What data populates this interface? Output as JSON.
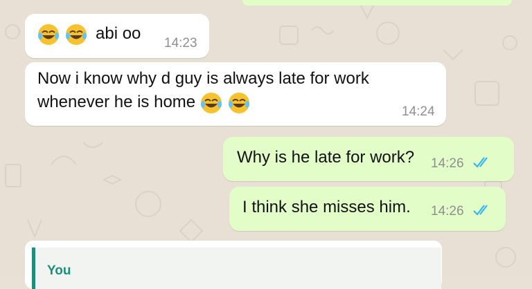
{
  "chat": {
    "messages": [
      {
        "direction": "incoming",
        "text": "abi oo",
        "time": "14:23",
        "emoji": "tears-of-joy-emoji"
      },
      {
        "direction": "incoming",
        "text": "Now i know why d guy is always late for work\nwhenever he is home",
        "time": "14:24",
        "emoji": "tears-of-joy-emoji"
      },
      {
        "direction": "outgoing",
        "text": "Why is he late for work?",
        "time": "14:26",
        "status": "read-double-tick"
      },
      {
        "direction": "outgoing",
        "text": "I think she misses him.",
        "time": "14:26",
        "status": "read-double-tick"
      }
    ],
    "reply_preview": {
      "author": "You"
    }
  },
  "colors": {
    "wallpaper": "#e8e0d5",
    "incoming_bubble": "#ffffff",
    "outgoing_bubble": "#e3fdc9",
    "read_tick": "#34b7f1",
    "reply_accent": "#1f8f7b"
  }
}
